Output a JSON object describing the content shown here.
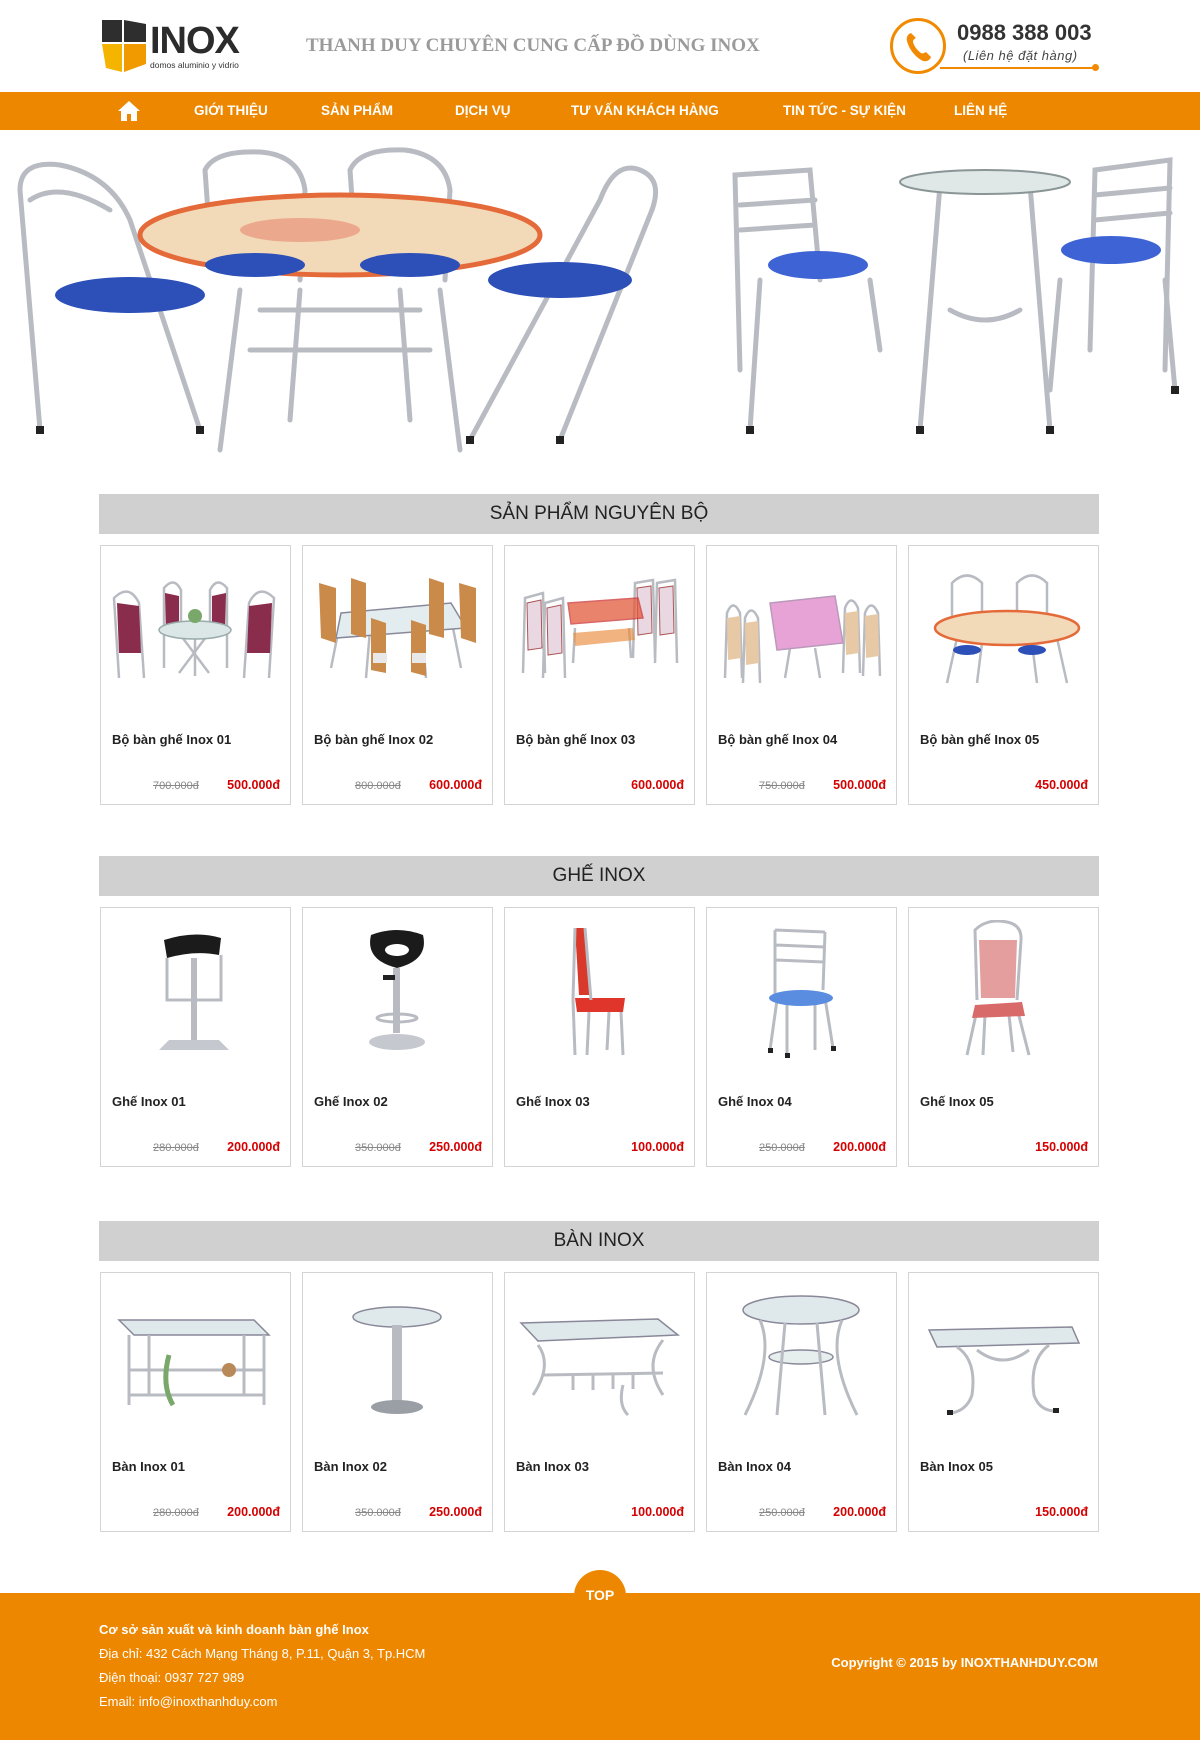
{
  "header": {
    "logo_text": "INOX",
    "logo_subtext": "domos aluminio y vidrio",
    "tagline": "THANH DUY CHUYÊN CUNG CẤP ĐỒ DÙNG INOX",
    "phone": "0988 388 003",
    "phone_note": "(Liên hệ đặt hàng)"
  },
  "nav": {
    "items": [
      "GIỚI THIỆU",
      "SẢN PHẨM",
      "DỊCH VỤ",
      "TƯ VẤN KHÁCH HÀNG",
      "TIN TỨC - SỰ KIỆN",
      "LIÊN HỆ"
    ]
  },
  "sections": [
    {
      "title": "SẢN PHẨM NGUYÊN BỘ",
      "products": [
        {
          "name": "Bộ bàn ghế Inox 01",
          "old_price": "700.000đ",
          "price": "500.000đ"
        },
        {
          "name": "Bộ bàn ghế Inox 02",
          "old_price": "800.000đ",
          "price": "600.000đ"
        },
        {
          "name": "Bộ bàn ghế Inox 03",
          "old_price": "",
          "price": "600.000đ"
        },
        {
          "name": "Bộ bàn ghế Inox 04",
          "old_price": "750.000đ",
          "price": "500.000đ"
        },
        {
          "name": "Bộ bàn ghế Inox 05",
          "old_price": "",
          "price": "450.000đ"
        }
      ]
    },
    {
      "title": "GHẾ INOX",
      "products": [
        {
          "name": "Ghế Inox 01",
          "old_price": "280.000đ",
          "price": "200.000đ"
        },
        {
          "name": "Ghế Inox 02",
          "old_price": "350.000đ",
          "price": "250.000đ"
        },
        {
          "name": "Ghế Inox 03",
          "old_price": "",
          "price": "100.000đ"
        },
        {
          "name": "Ghế Inox 04",
          "old_price": "250.000đ",
          "price": "200.000đ"
        },
        {
          "name": "Ghế Inox 05",
          "old_price": "",
          "price": "150.000đ"
        }
      ]
    },
    {
      "title": "BÀN INOX",
      "products": [
        {
          "name": "Bàn Inox 01",
          "old_price": "280.000đ",
          "price": "200.000đ"
        },
        {
          "name": "Bàn Inox 02",
          "old_price": "350.000đ",
          "price": "250.000đ"
        },
        {
          "name": "Bàn Inox 03",
          "old_price": "",
          "price": "100.000đ"
        },
        {
          "name": "Bàn Inox 04",
          "old_price": "250.000đ",
          "price": "200.000đ"
        },
        {
          "name": "Bàn Inox 05",
          "old_price": "",
          "price": "150.000đ"
        }
      ]
    }
  ],
  "footer": {
    "top_label": "TOP",
    "company": "Cơ sở sản xuất và kinh doanh bàn ghế Inox",
    "address": "Địa chỉ: 432 Cách Mạng Tháng 8, P.11, Quận 3, Tp.HCM",
    "phone": "Điện thoại: 0937 727 989",
    "email": "Email: info@inoxthanhduy.com",
    "copyright": "Copyright © 2015 by INOXTHANHDUY.COM"
  },
  "colors": {
    "accent": "#ee8700",
    "price": "#d60000",
    "section_bg": "#d0d0d0",
    "chair_seat": "#2c4fb8",
    "steel": "#b8bcc2"
  },
  "icons": [
    "home-icon",
    "phone-icon"
  ]
}
